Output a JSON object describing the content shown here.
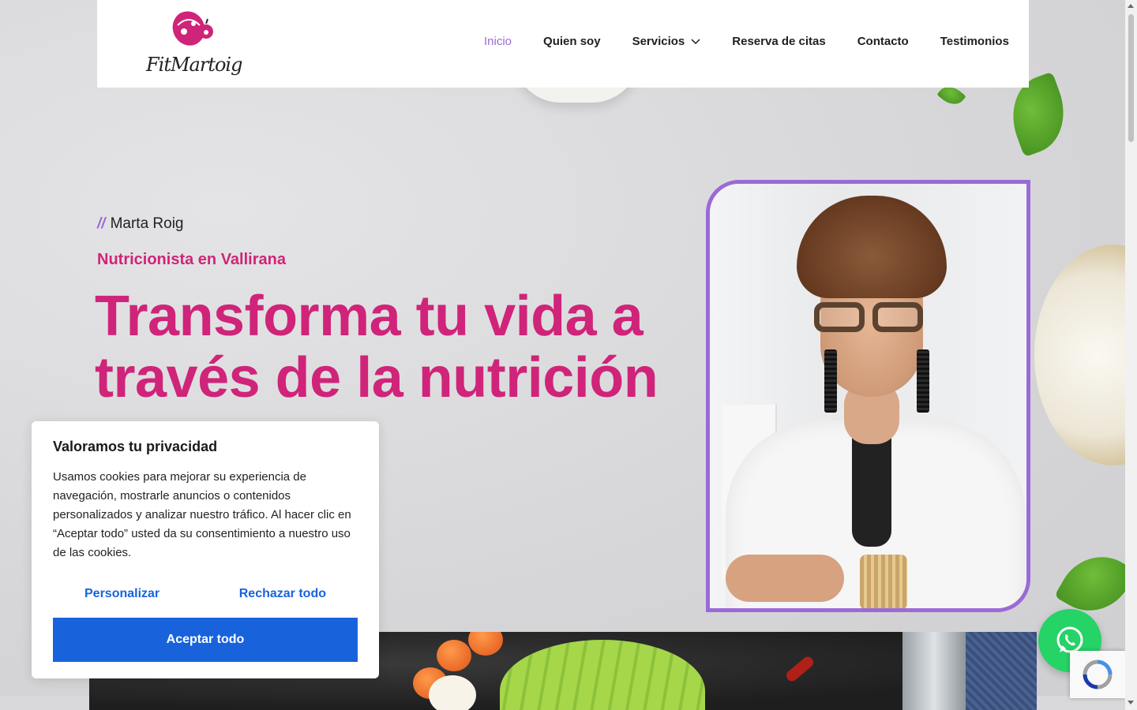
{
  "brand": {
    "logo_text": "FitMartoig"
  },
  "nav": {
    "items": [
      {
        "label": "Inicio",
        "active": true
      },
      {
        "label": "Quien soy"
      },
      {
        "label": "Servicios",
        "has_dropdown": true
      },
      {
        "label": "Reserva de citas"
      },
      {
        "label": "Contacto"
      },
      {
        "label": "Testimonios"
      }
    ]
  },
  "hero": {
    "eyebrow_slashes": "//",
    "eyebrow": "Marta Roig",
    "subtitle": "Nutricionista en Vallirana",
    "headline": "Transforma tu vida a través de la nutrición"
  },
  "cookie": {
    "title": "Valoramos tu privacidad",
    "body": "Usamos cookies para mejorar su experiencia de navegación, mostrarle anuncios o contenidos personalizados y analizar nuestro tráfico. Al hacer clic en “Aceptar todo” usted da su consentimiento a nuestro uso de las cookies.",
    "customize_label": "Personalizar",
    "reject_label": "Rechazar todo",
    "accept_label": "Aceptar todo"
  },
  "icons": {
    "whatsapp": "whatsapp-icon",
    "recaptcha": "recaptcha-icon",
    "chevron": "chevron-down-icon"
  },
  "colors": {
    "accent_pink": "#cf2479",
    "accent_purple": "#9b6ad6",
    "cookie_blue": "#1863dc",
    "whatsapp_green": "#25d366"
  }
}
